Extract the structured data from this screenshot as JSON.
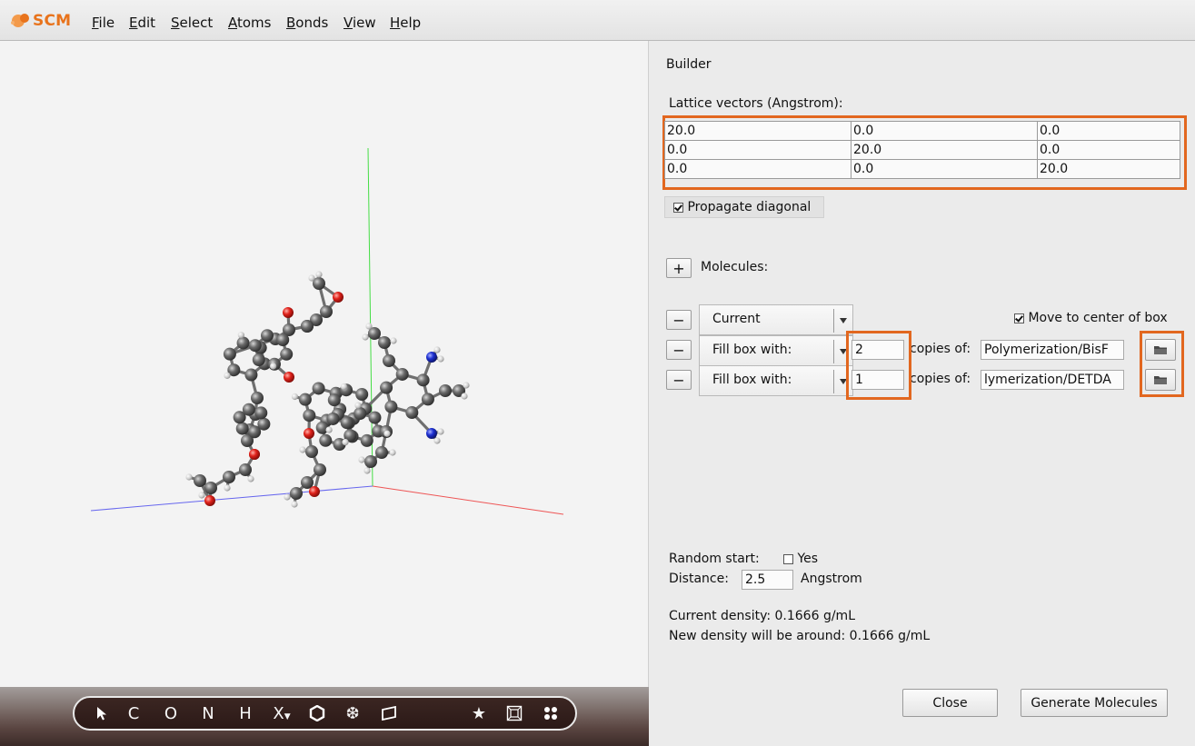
{
  "app": {
    "brand": "SCM"
  },
  "menu": [
    {
      "mnemonic": "F",
      "rest": "ile"
    },
    {
      "mnemonic": "E",
      "rest": "dit"
    },
    {
      "mnemonic": "S",
      "rest": "elect"
    },
    {
      "mnemonic": "A",
      "rest": "toms"
    },
    {
      "mnemonic": "B",
      "rest": "onds"
    },
    {
      "mnemonic": "V",
      "rest": "iew"
    },
    {
      "mnemonic": "H",
      "rest": "elp"
    }
  ],
  "toolbar": {
    "carbon": "C",
    "oxygen": "O",
    "nitrogen": "N",
    "hydrogen": "H",
    "other": "X"
  },
  "builder": {
    "title": "Builder",
    "lattice_label": "Lattice vectors (Angstrom):",
    "lattice": [
      [
        "20.0",
        "0.0",
        "0.0"
      ],
      [
        "0.0",
        "20.0",
        "0.0"
      ],
      [
        "0.0",
        "0.0",
        "20.0"
      ]
    ],
    "propagate_diagonal": {
      "label": "Propagate diagonal",
      "checked": true
    },
    "add_button": "+",
    "molecules_label": "Molecules:",
    "remove_button": "−",
    "move_to_center": {
      "label": "Move to center of box",
      "checked": true
    },
    "rows": [
      {
        "mode": "Current"
      },
      {
        "mode": "Fill box with:",
        "copies": "2",
        "copies_label": "copies of:",
        "path": "Polymerization/BisF"
      },
      {
        "mode": "Fill box with:",
        "copies": "1",
        "copies_label": "copies of:",
        "path": "lymerization/DETDA"
      }
    ],
    "random_start": {
      "label": "Random start:",
      "option": "Yes",
      "checked": false
    },
    "distance": {
      "label": "Distance:",
      "value": "2.5",
      "unit": "Angstrom"
    },
    "current_density": "Current density: 0.1666 g/mL",
    "new_density": "New density will be around: 0.1666 g/mL",
    "close_button": "Close",
    "generate_button": "Generate Molecules"
  },
  "colors": {
    "accent": "#e2671f",
    "brand": "#e8731c",
    "carbon": "#5a5a5a",
    "oxygen": "#e0221b",
    "nitrogen": "#1c2fd1",
    "hydrogen": "#d8d8d8"
  },
  "icons": [
    "scm-logo-icon",
    "select-arrow-icon",
    "hexagon-icon",
    "snowflake-icon",
    "parallelogram-icon",
    "star-icon",
    "box-icon",
    "dots-icon",
    "folder-icon"
  ]
}
